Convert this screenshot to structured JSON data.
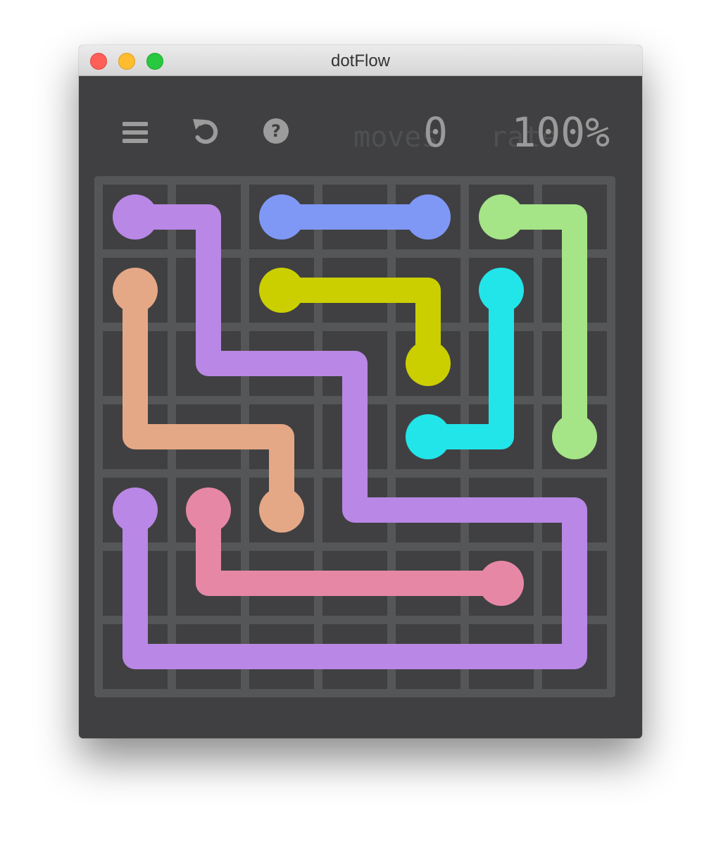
{
  "window": {
    "title": "dotFlow"
  },
  "toolbar": {
    "menu_icon": "hamburger-menu-icon",
    "undo_icon": "undo-arrow-icon",
    "help_icon": "question-mark-icon",
    "help_glyph": "?"
  },
  "stats": {
    "moves_label": "moves",
    "moves_value": "0",
    "rate_label": "rate",
    "rate_value": "100%"
  },
  "board": {
    "rows": 7,
    "cols": 7,
    "grid_color": "#555657",
    "background_color": "#404042",
    "flows": [
      {
        "name": "purple",
        "color": "#b987e5",
        "path": [
          [
            0,
            0
          ],
          [
            0,
            1
          ],
          [
            2,
            1
          ],
          [
            2,
            3
          ],
          [
            4,
            3
          ],
          [
            4,
            6
          ],
          [
            6,
            6
          ],
          [
            6,
            0
          ],
          [
            4,
            0
          ]
        ],
        "endpoints": [
          [
            0,
            0
          ],
          [
            4,
            0
          ]
        ]
      },
      {
        "name": "blue",
        "color": "#7f98f6",
        "path": [
          [
            0,
            2
          ],
          [
            0,
            4
          ]
        ],
        "endpoints": [
          [
            0,
            2
          ],
          [
            0,
            4
          ]
        ]
      },
      {
        "name": "green",
        "color": "#a5e487",
        "path": [
          [
            0,
            5
          ],
          [
            0,
            6
          ],
          [
            3,
            6
          ]
        ],
        "endpoints": [
          [
            0,
            5
          ],
          [
            3,
            6
          ]
        ]
      },
      {
        "name": "salmon",
        "color": "#e5a886",
        "path": [
          [
            1,
            0
          ],
          [
            3,
            0
          ],
          [
            3,
            2
          ],
          [
            4,
            2
          ]
        ],
        "endpoints": [
          [
            1,
            0
          ],
          [
            4,
            2
          ]
        ]
      },
      {
        "name": "olive",
        "color": "#cbcf00",
        "path": [
          [
            1,
            2
          ],
          [
            1,
            4
          ],
          [
            2,
            4
          ]
        ],
        "endpoints": [
          [
            1,
            2
          ],
          [
            2,
            4
          ]
        ]
      },
      {
        "name": "cyan",
        "color": "#22e5e9",
        "path": [
          [
            1,
            5
          ],
          [
            3,
            5
          ],
          [
            3,
            4
          ]
        ],
        "endpoints": [
          [
            1,
            5
          ],
          [
            3,
            4
          ]
        ]
      },
      {
        "name": "pink",
        "color": "#e688a5",
        "path": [
          [
            4,
            1
          ],
          [
            5,
            1
          ],
          [
            5,
            5
          ]
        ],
        "endpoints": [
          [
            4,
            1
          ],
          [
            5,
            5
          ]
        ]
      }
    ]
  }
}
